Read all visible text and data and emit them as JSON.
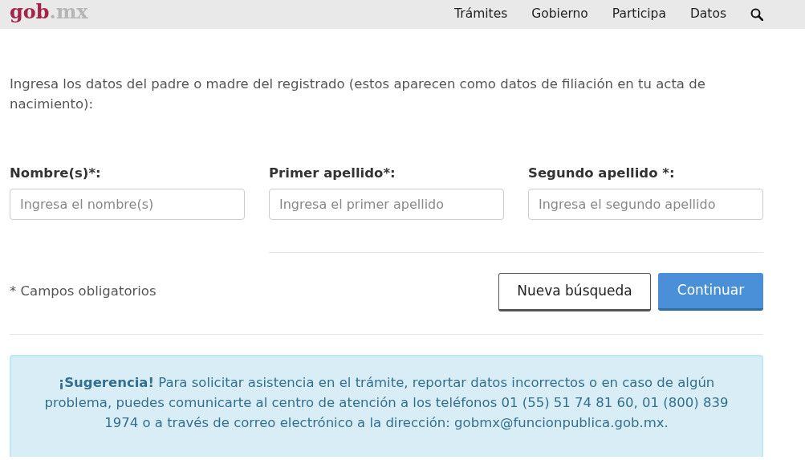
{
  "header": {
    "logo_main": "gob",
    "logo_suffix": ".mx",
    "nav": [
      {
        "label": "Trámites"
      },
      {
        "label": "Gobierno"
      },
      {
        "label": "Participa"
      },
      {
        "label": "Datos"
      }
    ]
  },
  "intro": "Ingresa los datos del padre o madre del registrado (estos aparecen como datos de filiación en tu acta de nacimiento):",
  "fields": [
    {
      "label": "Nombre(s)*:",
      "placeholder": "Ingresa el nombre(s)"
    },
    {
      "label": "Primer apellido*:",
      "placeholder": "Ingresa el primer apellido"
    },
    {
      "label": "Segundo apellido *:",
      "placeholder": "Ingresa el segundo apellido"
    }
  ],
  "required_note": "* Campos obligatorios",
  "buttons": [
    {
      "label": "Nueva búsqueda",
      "kind": "secondary"
    },
    {
      "label": "Continuar",
      "kind": "primary"
    }
  ],
  "alert": "**¡Sugerencia!** Para solicitar asistencia en el trámite, reportar datos incorrectos o en caso de algún problema, puedes comunicarte al centro de atención a los teléfonos 01 (55) 51 74 81 60, 01 (800) 839 1974 o a través de correo electrónico a la dirección: gobmx@funcionpublica.gob.mx."
}
